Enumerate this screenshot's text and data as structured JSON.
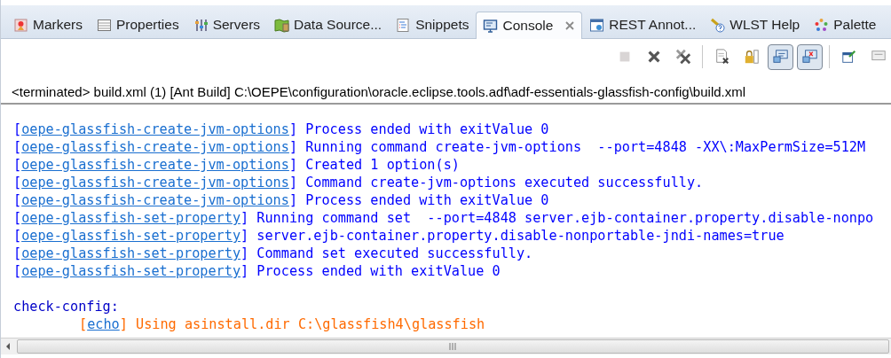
{
  "tabs": [
    {
      "kind": "markers",
      "label": "Markers",
      "selected": false
    },
    {
      "kind": "properties",
      "label": "Properties",
      "selected": false
    },
    {
      "kind": "servers",
      "label": "Servers",
      "selected": false
    },
    {
      "kind": "datasource",
      "label": "Data Source...",
      "selected": false
    },
    {
      "kind": "snippets",
      "label": "Snippets",
      "selected": false
    },
    {
      "kind": "console",
      "label": "Console",
      "selected": true
    },
    {
      "kind": "rest",
      "label": "REST Annot...",
      "selected": false
    },
    {
      "kind": "help",
      "label": "WLST Help",
      "selected": false
    },
    {
      "kind": "palette",
      "label": "Palette",
      "selected": false
    }
  ],
  "toolbar": [
    {
      "kind": "terminate",
      "disabled": true,
      "pressed": false
    },
    {
      "kind": "remove",
      "disabled": false,
      "pressed": false
    },
    {
      "kind": "remove-all",
      "disabled": false,
      "pressed": false
    },
    {
      "kind": "clear",
      "disabled": false,
      "pressed": false
    },
    {
      "kind": "scroll-lock",
      "disabled": false,
      "pressed": false
    },
    {
      "kind": "stdout",
      "disabled": false,
      "pressed": true
    },
    {
      "kind": "stderr",
      "disabled": false,
      "pressed": true
    },
    {
      "kind": "pin",
      "disabled": false,
      "pressed": false
    },
    {
      "kind": "display",
      "disabled": false,
      "pressed": false
    }
  ],
  "console": {
    "title": "<terminated> build.xml (1) [Ant Build] C:\\OEPE\\configuration\\oracle.eclipse.tools.adf\\adf-essentials-glassfish-config\\build.xml",
    "lines": [
      {
        "kind": "task",
        "prefix": "[",
        "task": "oepe-glassfish-create-jvm-options",
        "message": "] Process ended with exitValue 0",
        "color": "#0000ff"
      },
      {
        "kind": "task",
        "prefix": "[",
        "task": "oepe-glassfish-create-jvm-options",
        "message": "] Running command create-jvm-options  --port=4848 -XX\\:MaxPermSize=512M",
        "color": "#0000ff"
      },
      {
        "kind": "task",
        "prefix": "[",
        "task": "oepe-glassfish-create-jvm-options",
        "message": "] Created 1 option(s)",
        "color": "#0000ff"
      },
      {
        "kind": "task",
        "prefix": "[",
        "task": "oepe-glassfish-create-jvm-options",
        "message": "] Command create-jvm-options executed successfully.",
        "color": "#0000ff"
      },
      {
        "kind": "task",
        "prefix": "[",
        "task": "oepe-glassfish-create-jvm-options",
        "message": "] Process ended with exitValue 0",
        "color": "#0000ff"
      },
      {
        "kind": "task",
        "prefix": "[",
        "task": "oepe-glassfish-set-property",
        "message": "] Running command set  --port=4848 server.ejb-container.property.disable-nonpo",
        "color": "#0000ff"
      },
      {
        "kind": "task",
        "prefix": "[",
        "task": "oepe-glassfish-set-property",
        "message": "] server.ejb-container.property.disable-nonportable-jndi-names=true",
        "color": "#0000ff"
      },
      {
        "kind": "task",
        "prefix": "[",
        "task": "oepe-glassfish-set-property",
        "message": "] Command set executed successfully.",
        "color": "#0000ff"
      },
      {
        "kind": "task",
        "prefix": "[",
        "task": "oepe-glassfish-set-property",
        "message": "] Process ended with exitValue 0",
        "color": "#0000ff"
      },
      {
        "kind": "blank"
      },
      {
        "kind": "target",
        "text": "check-config:",
        "children": [
          {
            "kind": "task",
            "prefix": "[",
            "task": "echo",
            "message": "] Using asinstall.dir C:\\glassfish4\\glassfish",
            "color": "#ff6a00"
          }
        ]
      }
    ]
  }
}
